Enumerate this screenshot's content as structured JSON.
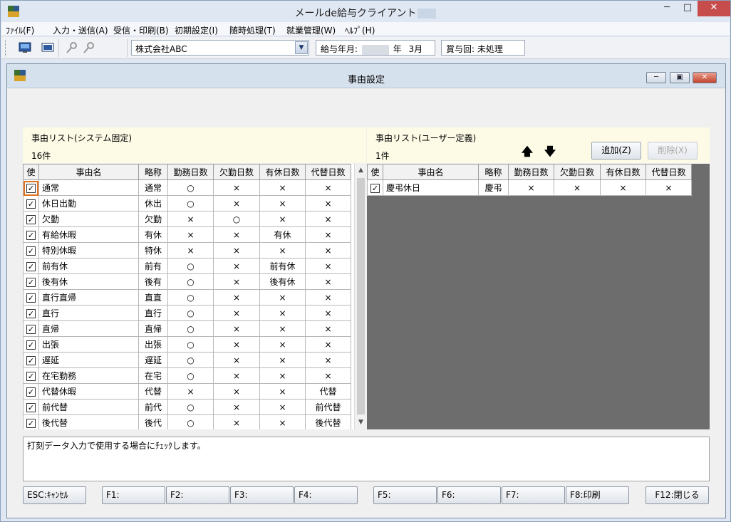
{
  "app": {
    "title": "メールde給与クライアント",
    "window_controls": {
      "minimize": "─",
      "maximize": "□",
      "close": "✕"
    }
  },
  "menu": [
    "ﾌｧｲﾙ(F)",
    "入力・送信(A)",
    "受信・印刷(B)",
    "初期設定(I)",
    "随時処理(T)",
    "就業管理(W)",
    "ﾍﾙﾌﾟ(H)"
  ],
  "toolbar": {
    "company": "株式会社ABC",
    "combo_arrow": "▼",
    "pay_month_label": "給与年月:",
    "pay_month_year_unit": "年",
    "pay_month_month": "3月",
    "bonus_label": "賞与回:",
    "bonus_value": "未処理"
  },
  "child": {
    "title": "事由設定",
    "controls": {
      "minimize": "─",
      "restore": "▣",
      "close": "✕"
    }
  },
  "system_list": {
    "title": "事由リスト(システム固定)",
    "count": "16件",
    "columns": [
      "使",
      "事由名",
      "略称",
      "勤務日数",
      "欠勤日数",
      "有休日数",
      "代替日数"
    ],
    "rows": [
      {
        "name": "通常",
        "abbr": "通常",
        "work": "○",
        "absent": "×",
        "paid": "×",
        "sub": "×"
      },
      {
        "name": "休日出勤",
        "abbr": "休出",
        "work": "○",
        "absent": "×",
        "paid": "×",
        "sub": "×"
      },
      {
        "name": "欠勤",
        "abbr": "欠勤",
        "work": "×",
        "absent": "○",
        "paid": "×",
        "sub": "×"
      },
      {
        "name": "有給休暇",
        "abbr": "有休",
        "work": "×",
        "absent": "×",
        "paid": "有休",
        "sub": "×"
      },
      {
        "name": "特別休暇",
        "abbr": "特休",
        "work": "×",
        "absent": "×",
        "paid": "×",
        "sub": "×"
      },
      {
        "name": "前有休",
        "abbr": "前有",
        "work": "○",
        "absent": "×",
        "paid": "前有休",
        "sub": "×"
      },
      {
        "name": "後有休",
        "abbr": "後有",
        "work": "○",
        "absent": "×",
        "paid": "後有休",
        "sub": "×"
      },
      {
        "name": "直行直帰",
        "abbr": "直直",
        "work": "○",
        "absent": "×",
        "paid": "×",
        "sub": "×"
      },
      {
        "name": "直行",
        "abbr": "直行",
        "work": "○",
        "absent": "×",
        "paid": "×",
        "sub": "×"
      },
      {
        "name": "直帰",
        "abbr": "直帰",
        "work": "○",
        "absent": "×",
        "paid": "×",
        "sub": "×"
      },
      {
        "name": "出張",
        "abbr": "出張",
        "work": "○",
        "absent": "×",
        "paid": "×",
        "sub": "×"
      },
      {
        "name": "遅延",
        "abbr": "遅延",
        "work": "○",
        "absent": "×",
        "paid": "×",
        "sub": "×"
      },
      {
        "name": "在宅勤務",
        "abbr": "在宅",
        "work": "○",
        "absent": "×",
        "paid": "×",
        "sub": "×"
      },
      {
        "name": "代替休暇",
        "abbr": "代替",
        "work": "×",
        "absent": "×",
        "paid": "×",
        "sub": "代替"
      },
      {
        "name": "前代替",
        "abbr": "前代",
        "work": "○",
        "absent": "×",
        "paid": "×",
        "sub": "前代替"
      },
      {
        "name": "後代替",
        "abbr": "後代",
        "work": "○",
        "absent": "×",
        "paid": "×",
        "sub": "後代替"
      }
    ]
  },
  "user_list": {
    "title": "事由リスト(ユーザー定義)",
    "count": "1件",
    "up_arrow": "🡅",
    "down_arrow": "🡇",
    "add_label": "追加(Z)",
    "delete_label": "削除(X)",
    "columns": [
      "使",
      "事由名",
      "略称",
      "勤務日数",
      "欠勤日数",
      "有休日数",
      "代替日数"
    ],
    "rows": [
      {
        "name": "慶弔休日",
        "abbr": "慶弔",
        "work": "×",
        "absent": "×",
        "paid": "×",
        "sub": "×"
      }
    ]
  },
  "message": "打刻データ入力で使用する場合にﾁｪｯｸします。",
  "fkeys": [
    "ESC:ｷｬﾝｾﾙ",
    "F1:",
    "F2:",
    "F3:",
    "F4:",
    "F5:",
    "F6:",
    "F7:",
    "F8:印刷",
    "F12:閉じる"
  ],
  "colors": {
    "panel_header_bg": "#fdfbe6",
    "grid_empty_bg": "#6d6d6d",
    "focus_outline": "#e0701c",
    "close_red": "#c74d4d"
  }
}
